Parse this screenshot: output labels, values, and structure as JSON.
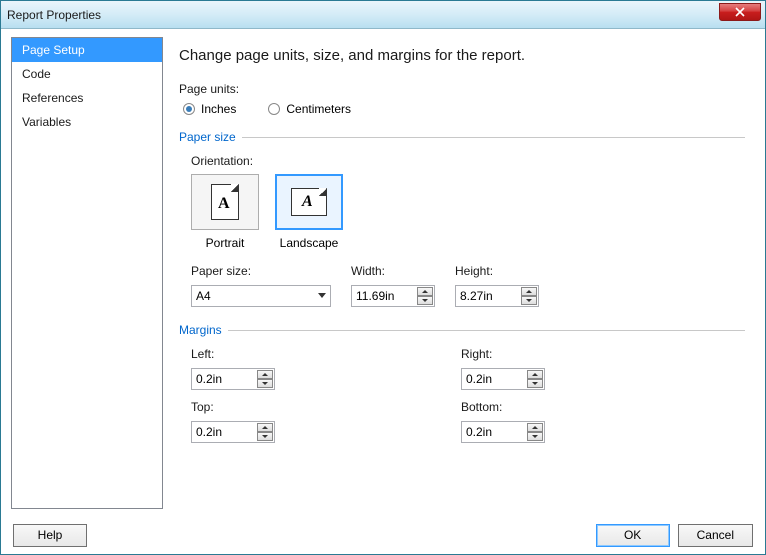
{
  "window": {
    "title": "Report Properties"
  },
  "sidebar": {
    "items": [
      {
        "label": "Page Setup",
        "selected": true
      },
      {
        "label": "Code",
        "selected": false
      },
      {
        "label": "References",
        "selected": false
      },
      {
        "label": "Variables",
        "selected": false
      }
    ]
  },
  "main": {
    "heading": "Change page units, size, and margins for the report.",
    "pageUnits": {
      "label": "Page units:",
      "options": [
        {
          "label": "Inches",
          "checked": true
        },
        {
          "label": "Centimeters",
          "checked": false
        }
      ]
    },
    "paperSize": {
      "groupLabel": "Paper size",
      "orientationLabel": "Orientation:",
      "orientation": {
        "options": [
          {
            "label": "Portrait",
            "selected": false
          },
          {
            "label": "Landscape",
            "selected": true
          }
        ]
      },
      "paperSizeLabel": "Paper size:",
      "paperSizeValue": "A4",
      "widthLabel": "Width:",
      "widthValue": "11.69in",
      "heightLabel": "Height:",
      "heightValue": "8.27in"
    },
    "margins": {
      "groupLabel": "Margins",
      "leftLabel": "Left:",
      "leftValue": "0.2in",
      "rightLabel": "Right:",
      "rightValue": "0.2in",
      "topLabel": "Top:",
      "topValue": "0.2in",
      "bottomLabel": "Bottom:",
      "bottomValue": "0.2in"
    }
  },
  "footer": {
    "help": "Help",
    "ok": "OK",
    "cancel": "Cancel"
  }
}
